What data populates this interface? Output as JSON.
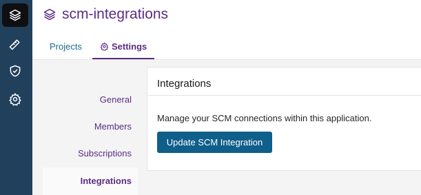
{
  "rail": {
    "items": [
      {
        "icon": "layers-icon",
        "active": true
      },
      {
        "icon": "ruler-icon",
        "active": false
      },
      {
        "icon": "shield-check-icon",
        "active": false
      },
      {
        "icon": "gear-icon",
        "active": false
      }
    ]
  },
  "header": {
    "title": "scm-integrations",
    "title_icon": "layers-icon",
    "tabs": [
      {
        "label": "Projects",
        "active": false
      },
      {
        "label": "Settings",
        "icon": "gear-icon",
        "active": true
      }
    ]
  },
  "subnav": {
    "items": [
      {
        "label": "General",
        "active": false
      },
      {
        "label": "Members",
        "active": false
      },
      {
        "label": "Subscriptions",
        "active": false
      },
      {
        "label": "Integrations",
        "active": true
      }
    ]
  },
  "panel": {
    "title": "Integrations",
    "description": "Manage your SCM connections within this application.",
    "button_label": "Update SCM Integration"
  },
  "colors": {
    "rail_bg": "#21405c",
    "accent_purple": "#5b2d82",
    "link_blue": "#1d6b8e",
    "primary_button": "#0f5f8a"
  }
}
